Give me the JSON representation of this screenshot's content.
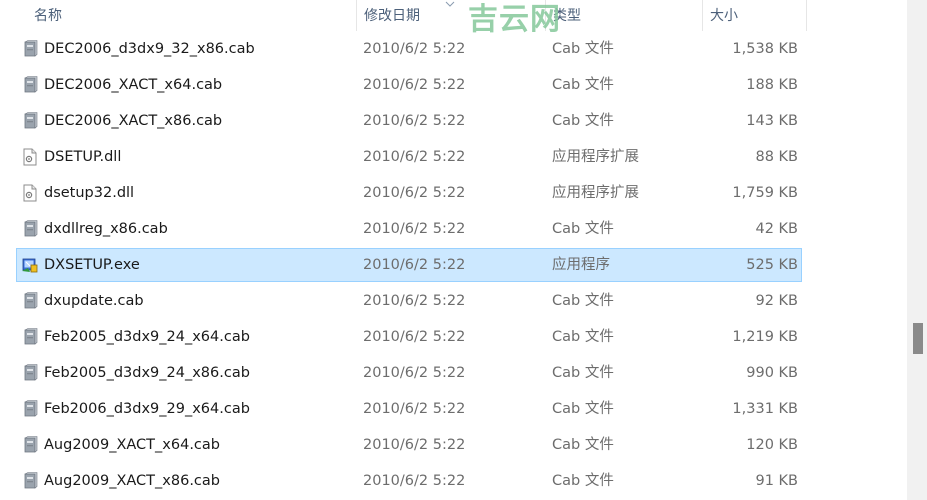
{
  "header": {
    "name": "名称",
    "date": "修改日期",
    "type": "类型",
    "size": "大小"
  },
  "watermark": "吉云网",
  "files": [
    {
      "name": "DEC2006_d3dx9_32_x86.cab",
      "date": "2010/6/2 5:22",
      "type": "Cab 文件",
      "size": "1,538 KB",
      "icon": "cab-file-icon"
    },
    {
      "name": "DEC2006_XACT_x64.cab",
      "date": "2010/6/2 5:22",
      "type": "Cab 文件",
      "size": "188 KB",
      "icon": "cab-file-icon"
    },
    {
      "name": "DEC2006_XACT_x86.cab",
      "date": "2010/6/2 5:22",
      "type": "Cab 文件",
      "size": "143 KB",
      "icon": "cab-file-icon"
    },
    {
      "name": "DSETUP.dll",
      "date": "2010/6/2 5:22",
      "type": "应用程序扩展",
      "size": "88 KB",
      "icon": "dll-file-icon"
    },
    {
      "name": "dsetup32.dll",
      "date": "2010/6/2 5:22",
      "type": "应用程序扩展",
      "size": "1,759 KB",
      "icon": "dll-file-icon"
    },
    {
      "name": "dxdllreg_x86.cab",
      "date": "2010/6/2 5:22",
      "type": "Cab 文件",
      "size": "42 KB",
      "icon": "cab-file-icon"
    },
    {
      "name": "DXSETUP.exe",
      "date": "2010/6/2 5:22",
      "type": "应用程序",
      "size": "525 KB",
      "icon": "setup-exe-icon",
      "selected": true
    },
    {
      "name": "dxupdate.cab",
      "date": "2010/6/2 5:22",
      "type": "Cab 文件",
      "size": "92 KB",
      "icon": "cab-file-icon"
    },
    {
      "name": "Feb2005_d3dx9_24_x64.cab",
      "date": "2010/6/2 5:22",
      "type": "Cab 文件",
      "size": "1,219 KB",
      "icon": "cab-file-icon"
    },
    {
      "name": "Feb2005_d3dx9_24_x86.cab",
      "date": "2010/6/2 5:22",
      "type": "Cab 文件",
      "size": "990 KB",
      "icon": "cab-file-icon"
    },
    {
      "name": "Feb2006_d3dx9_29_x64.cab",
      "date": "2010/6/2 5:22",
      "type": "Cab 文件",
      "size": "1,331 KB",
      "icon": "cab-file-icon"
    },
    {
      "name": "Aug2009_XACT_x64.cab",
      "date": "2010/6/2 5:22",
      "type": "Cab 文件",
      "size": "120 KB",
      "icon": "cab-file-icon"
    },
    {
      "name": "Aug2009_XACT_x86.cab",
      "date": "2010/6/2 5:22",
      "type": "Cab 文件",
      "size": "91 KB",
      "icon": "cab-file-icon"
    }
  ],
  "colors": {
    "selection_bg": "#cce8ff",
    "selection_border": "#99d1ff",
    "header_text": "#4c607a",
    "watermark": "#85c89b"
  }
}
